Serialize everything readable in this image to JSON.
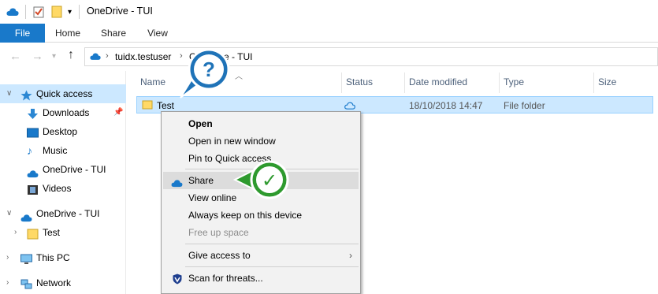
{
  "window": {
    "title": "OneDrive - TUI"
  },
  "ribbon": {
    "tabs": [
      "File",
      "Home",
      "Share",
      "View"
    ]
  },
  "address": {
    "crumbs": [
      "tuidx.testuser",
      "OneDrive - TUI"
    ]
  },
  "nav": {
    "items": [
      {
        "label": "Quick access"
      },
      {
        "label": "Downloads"
      },
      {
        "label": "Desktop"
      },
      {
        "label": "Music"
      },
      {
        "label": "OneDrive - TUI"
      },
      {
        "label": "Videos"
      },
      {
        "label": "OneDrive - TUI"
      },
      {
        "label": "Test"
      },
      {
        "label": "This PC"
      },
      {
        "label": "Network"
      }
    ]
  },
  "columns": {
    "name": "Name",
    "status": "Status",
    "date": "Date modified",
    "type": "Type",
    "size": "Size"
  },
  "file": {
    "name": "Test",
    "date": "18/10/2018 14:47",
    "type": "File folder"
  },
  "menu": {
    "items": [
      {
        "label": "Open"
      },
      {
        "label": "Open in new window"
      },
      {
        "label": "Pin to Quick access"
      },
      {
        "label": "Share"
      },
      {
        "label": "View online"
      },
      {
        "label": "Always keep on this device"
      },
      {
        "label": "Free up space"
      },
      {
        "label": "Give access to"
      },
      {
        "label": "Scan for threats..."
      }
    ]
  },
  "callouts": {
    "question": "?",
    "check": "✓"
  },
  "colors": {
    "accent": "#1979ca",
    "selection": "#cce8ff",
    "callout_blue": "#1f73b8",
    "callout_green": "#2e9a2e"
  }
}
